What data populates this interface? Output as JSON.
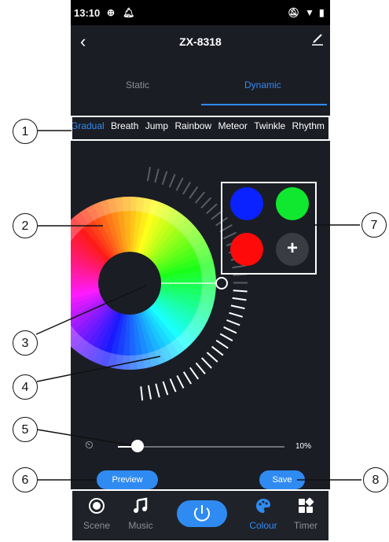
{
  "status_bar": {
    "time": "13:10",
    "icons": [
      "circle-plus-icon",
      "bell-icon",
      "mute-icon",
      "wifi-icon",
      "battery-icon"
    ]
  },
  "header": {
    "title": "ZX-8318",
    "back_icon": "chevron-left-icon",
    "edit_icon": "pencil-icon"
  },
  "tabs": [
    {
      "label": "Static"
    },
    {
      "label": "Dynamic",
      "active": true
    }
  ],
  "modes": [
    {
      "label": "Gradual",
      "active": true
    },
    {
      "label": "Breath"
    },
    {
      "label": "Jump"
    },
    {
      "label": "Rainbow"
    },
    {
      "label": "Meteor"
    },
    {
      "label": "Twinkle"
    },
    {
      "label": "Rhythm"
    }
  ],
  "swatches": {
    "colors": [
      "#0a22ff",
      "#0fe82e",
      "#ff0a0a"
    ],
    "add_label": "+"
  },
  "speed": {
    "icon": "speedometer-icon",
    "value": "10%",
    "fraction": 0.1
  },
  "buttons": {
    "preview": "Preview",
    "save": "Save"
  },
  "nav": [
    {
      "label": "Scene",
      "icon": "scene-icon"
    },
    {
      "label": "Music",
      "icon": "music-note-icon"
    },
    {
      "label": "",
      "icon": "power-icon"
    },
    {
      "label": "Colour",
      "icon": "palette-icon",
      "active": true
    },
    {
      "label": "Timer",
      "icon": "timer-grid-icon"
    }
  ],
  "callouts": [
    "1",
    "2",
    "3",
    "4",
    "5",
    "6",
    "7",
    "8"
  ],
  "colors": {
    "accent": "#2f8bf2",
    "background": "#1b1d25"
  }
}
